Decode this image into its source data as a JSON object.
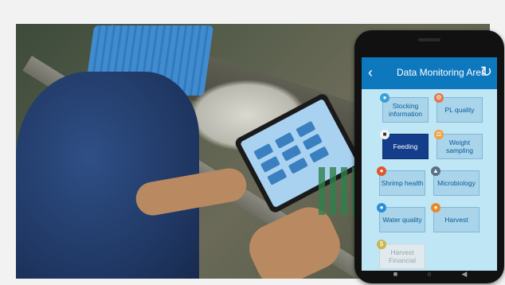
{
  "app": {
    "title": "Data Monitoring Area",
    "back_icon": "chevron-left-icon",
    "refresh_icon": "refresh-icon"
  },
  "menu": [
    {
      "label": "Stocking information",
      "icon": "fish-icon",
      "state": "normal"
    },
    {
      "label": "PL quality",
      "icon": "gear-icon",
      "state": "normal"
    },
    {
      "label": "Feeding",
      "icon": "feed-icon",
      "state": "selected"
    },
    {
      "label": "Weight sampling",
      "icon": "scale-icon",
      "state": "normal"
    },
    {
      "label": "Shrimp health",
      "icon": "shrimp-icon",
      "state": "normal"
    },
    {
      "label": "Microbiology",
      "icon": "microscope-icon",
      "state": "normal"
    },
    {
      "label": "Water quality",
      "icon": "droplet-icon",
      "state": "normal"
    },
    {
      "label": "Harvest",
      "icon": "harvest-icon",
      "state": "normal"
    },
    {
      "label": "Harvest Financial",
      "icon": "money-icon",
      "state": "disabled"
    }
  ],
  "nav": {
    "back": "square-icon",
    "home": "circle-icon",
    "recent": "triangle-icon"
  },
  "colors": {
    "appbar": "#0d78be",
    "tile": "#a9d4ea",
    "tile_selected": "#143d8c",
    "screen_bg": "#bfe6f5"
  }
}
